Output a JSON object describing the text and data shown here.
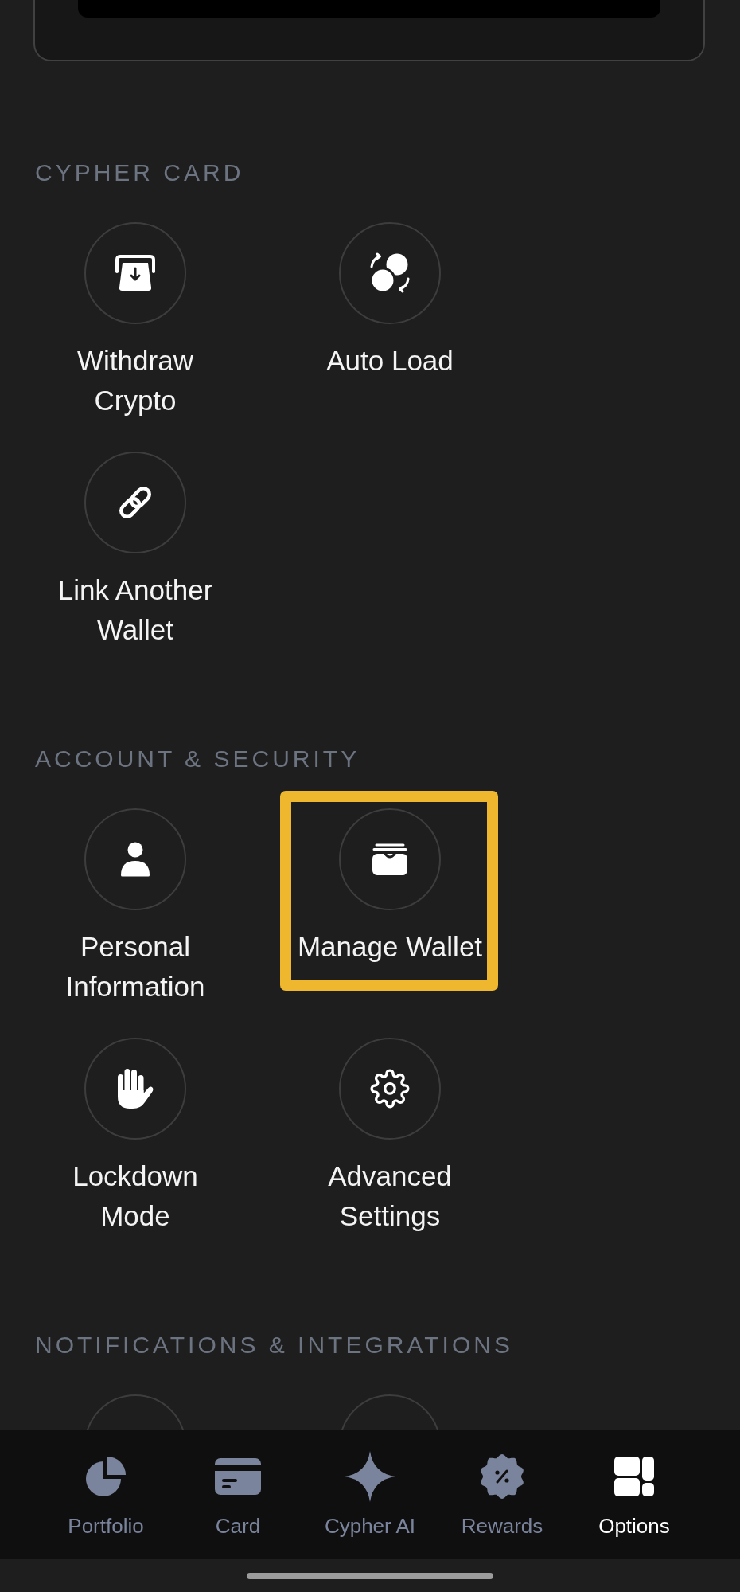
{
  "sections": [
    {
      "title": "CYPHER CARD",
      "items": [
        {
          "kind": "option",
          "label": "Withdraw Crypto",
          "highlighted": false
        },
        {
          "kind": "option",
          "label": "Auto Load",
          "highlighted": false
        },
        {
          "kind": "option",
          "label": "Link Another Wallet",
          "highlighted": false
        }
      ]
    },
    {
      "title": "ACCOUNT & SECURITY",
      "items": [
        {
          "kind": "option",
          "label": "Personal Information",
          "highlighted": false
        },
        {
          "kind": "option",
          "label": "Manage Wallet",
          "highlighted": true
        },
        {
          "kind": "option",
          "label": "Lockdown Mode",
          "highlighted": false
        },
        {
          "kind": "option",
          "label": "Advanced Settings",
          "highlighted": false
        }
      ]
    },
    {
      "title": "NOTIFICATIONS & INTEGRATIONS",
      "items": [
        {
          "kind": "clipped",
          "highlighted": false
        },
        {
          "kind": "clipped",
          "highlighted": false
        }
      ]
    }
  ],
  "tab_bar": {
    "tabs": [
      {
        "label": "Portfolio",
        "selected": false
      },
      {
        "label": "Card",
        "selected": false
      },
      {
        "label": "Cypher AI",
        "selected": false
      },
      {
        "label": "Rewards",
        "selected": false
      },
      {
        "label": "Options",
        "selected": true
      }
    ]
  }
}
